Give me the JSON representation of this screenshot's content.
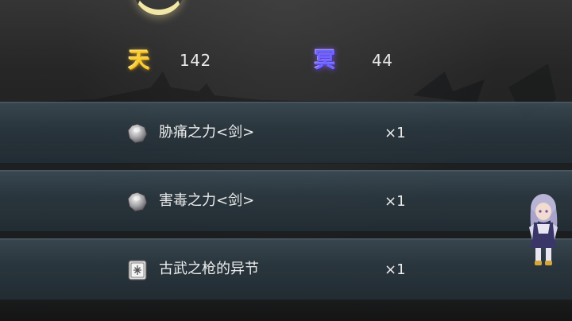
{
  "currencies": {
    "heaven": {
      "glyph": "天",
      "value": "142",
      "icon": "heaven-currency-icon",
      "color": "#f7cf32"
    },
    "underworld": {
      "glyph": "冥",
      "value": "44",
      "icon": "underworld-currency-icon",
      "color": "#6c67ff"
    }
  },
  "rewards": [
    {
      "name": "胁痛之力<剑>",
      "quantity": "×1",
      "icon": "gray-ore-icon"
    },
    {
      "name": "害毒之力<剑>",
      "quantity": "×1",
      "icon": "gray-ore-icon"
    },
    {
      "name": "古武之枪的异节",
      "quantity": "×1",
      "icon": "book-icon"
    }
  ]
}
